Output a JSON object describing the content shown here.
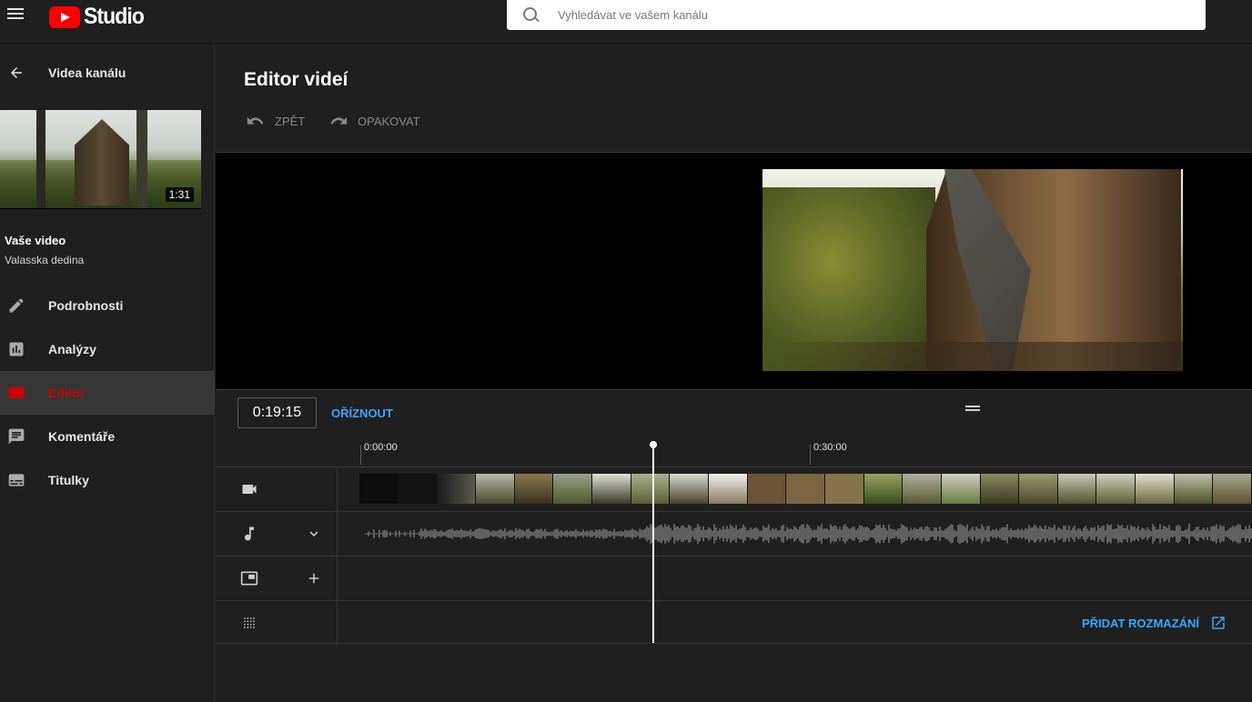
{
  "app": {
    "title": "Studio",
    "search_placeholder": "Vyhledávat ve vašem kanálu"
  },
  "sidebar": {
    "back_label": "Videa kanálu",
    "thumbnail_duration": "1:31",
    "your_video_label": "Vaše video",
    "video_name": "Valasska dedina",
    "items": [
      {
        "label": "Podrobnosti",
        "icon": "pencil-icon"
      },
      {
        "label": "Analýzy",
        "icon": "analytics-icon"
      },
      {
        "label": "Editor",
        "icon": "editor-icon",
        "active": true
      },
      {
        "label": "Komentáře",
        "icon": "comments-icon"
      },
      {
        "label": "Titulky",
        "icon": "subtitles-icon"
      }
    ]
  },
  "editor": {
    "title": "Editor videí",
    "undo_label": "ZPĚT",
    "redo_label": "OPAKOVAT",
    "timecode": "0:19:15",
    "trim_label": "OŘÍZNOUT",
    "ruler": [
      "0:00:00",
      "0:30:00"
    ],
    "add_blur_label": "PŘIDAT ROZMAZÁNÍ"
  },
  "colors": {
    "accent": "#3ea6ff",
    "active_red": "#cc0000",
    "brand_red": "#ff0000"
  }
}
